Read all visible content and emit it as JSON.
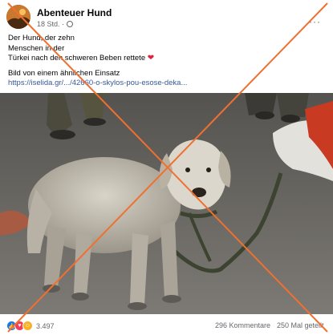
{
  "post": {
    "author": "Abenteuer Hund",
    "time": "18 Std. ·",
    "more": "···",
    "text_lines": [
      "Der Hund, der zehn",
      "Menschen in der",
      "Türkei nach den schweren Beben rettete"
    ],
    "text_note": "Bild von einem  ähnlichen Einsatz",
    "link": "https://iselida.gr/.../42660-o-skylos-pou-esose-deka...",
    "reactions_count": "3.497",
    "comments": "296 Kommentare",
    "shares": "250 Mal geteilt"
  },
  "icons": {
    "avatar": "avatar",
    "globe": "globe-icon",
    "heart": "heart-emoji",
    "like": "like-reaction-icon",
    "love": "love-reaction-icon",
    "care": "care-reaction-icon",
    "cross": "red-cross-overlay"
  },
  "colors": {
    "heart": "#e41e3f",
    "link": "#385898",
    "cross": "#f07030"
  }
}
